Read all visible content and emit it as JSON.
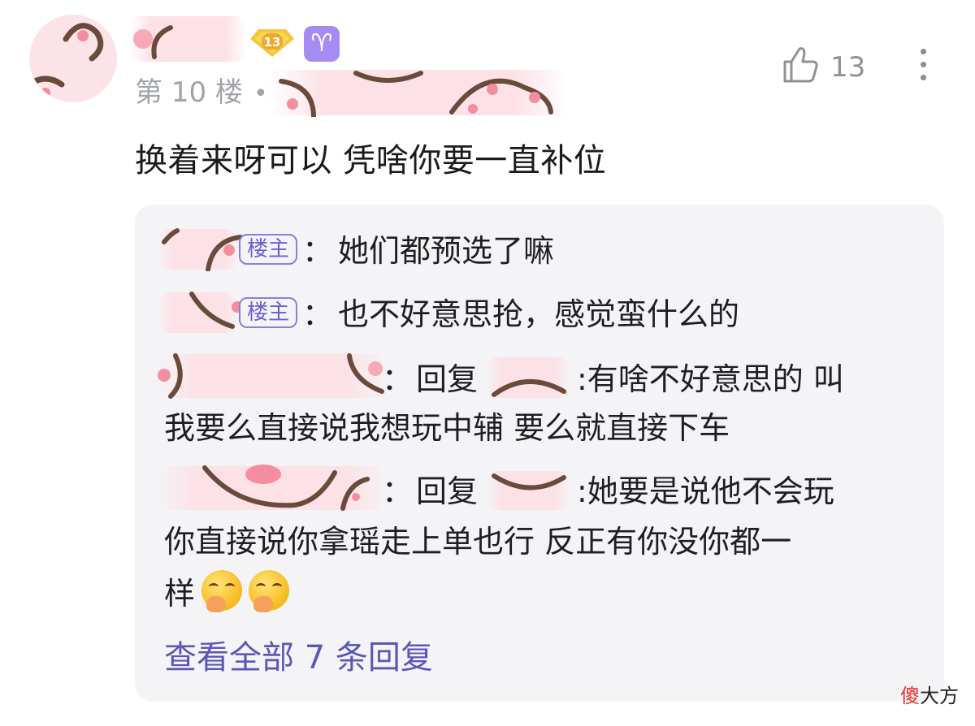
{
  "comment": {
    "level": "13",
    "zodiac_glyph": "♈",
    "floor": "第 10 楼",
    "floor_separator": "•",
    "like_count": "13",
    "text": "换着来呀可以 凭啥你要一直补位"
  },
  "replies": [
    {
      "tag": "楼主",
      "text": "她们都预选了嘛"
    },
    {
      "tag": "楼主",
      "text": "也不好意思抢，感觉蛮什么的"
    },
    {
      "reply_word": "回复",
      "text_line1": ":有啥不好意思的 叫",
      "text_line2": "我要么直接说我想玩中辅 要么就直接下车"
    },
    {
      "reply_word": "回复",
      "text_line1": ":她要是说他不会玩",
      "text_line2": "你直接说你拿瑶走上单也行 反正有你没你都一",
      "text_line3": "样"
    }
  ],
  "colon": "：",
  "view_all": "查看全部 7 条回复",
  "watermark": {
    "accent": "傻",
    "rest": "大方"
  },
  "colors": {
    "accent_purple": "#5b57b8",
    "owner_tag": "#8b7fd9",
    "redaction": "#fce2e7",
    "reply_bg": "#f4f4f6"
  },
  "icons": [
    "like-icon",
    "more-icon",
    "level-badge-icon",
    "aries-icon",
    "emoji-cover-mouth"
  ]
}
